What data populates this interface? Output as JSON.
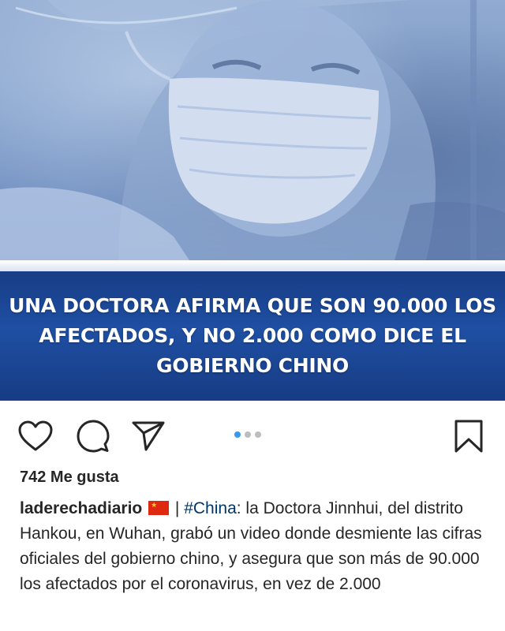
{
  "post": {
    "headline": "UNA DOCTORA AFIRMA QUE SON 90.000 LOS AFECTADOS, Y NO 2.000 COMO DICE EL GOBIERNO CHINO",
    "icons": {
      "like": "heart-icon",
      "comment": "comment-icon",
      "share": "paper-plane-icon",
      "save": "bookmark-icon",
      "flag": "china-flag-icon"
    },
    "carousel": {
      "total": 3,
      "active_index": 0
    },
    "likes_text": "742 Me gusta",
    "caption": {
      "username": "laderechadiario",
      "separator": " | ",
      "hashtag": "#China",
      "text": ": la Doctora Jinnhui, del distrito Hankou, en Wuhan, grabó un video donde desmiente las cifras oficiales del gobierno chino, y asegura que son más de 90.000 los afectados por el coronavirus, en vez de 2.000"
    },
    "colors": {
      "banner_blue": "#1f4fa3",
      "active_dot": "#3897f0",
      "inactive_dot": "#bdbdbd",
      "hashtag": "#003569",
      "text": "#262626"
    }
  }
}
